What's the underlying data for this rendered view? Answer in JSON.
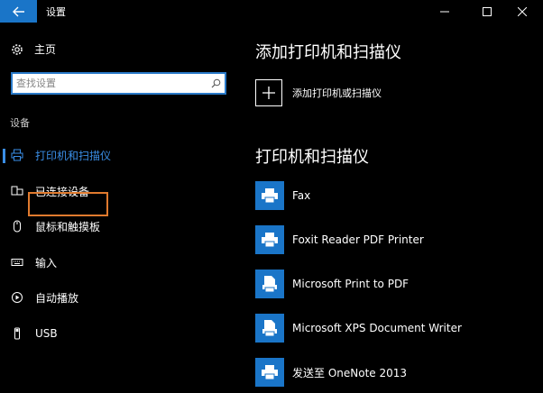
{
  "window": {
    "title": "设置"
  },
  "sidebar": {
    "home_label": "主页",
    "search_placeholder": "查找设置",
    "section_label": "设备",
    "items": [
      {
        "label": "打印机和扫描仪",
        "icon": "printer-icon",
        "active": true
      },
      {
        "label": "已连接设备",
        "icon": "connected-devices-icon"
      },
      {
        "label": "鼠标和触摸板",
        "icon": "mouse-icon",
        "highlighted": true
      },
      {
        "label": "输入",
        "icon": "keyboard-icon"
      },
      {
        "label": "自动播放",
        "icon": "autoplay-icon"
      },
      {
        "label": "USB",
        "icon": "usb-icon"
      }
    ]
  },
  "main": {
    "add_section_title": "添加打印机和扫描仪",
    "add_button_label": "添加打印机或扫描仪",
    "list_title": "打印机和扫描仪",
    "printers": [
      {
        "name": "Fax",
        "icon": "printer-icon"
      },
      {
        "name": "Foxit Reader PDF Printer",
        "icon": "printer-icon"
      },
      {
        "name": "Microsoft Print to PDF",
        "icon": "document-printer-icon"
      },
      {
        "name": "Microsoft XPS Document Writer",
        "icon": "document-printer-icon"
      },
      {
        "name": "发送至 OneNote 2013",
        "icon": "printer-icon"
      }
    ]
  },
  "colors": {
    "accent": "#1a75c8",
    "active_text": "#3a8ee6",
    "highlight": "#e07a2e",
    "background": "#000000"
  }
}
